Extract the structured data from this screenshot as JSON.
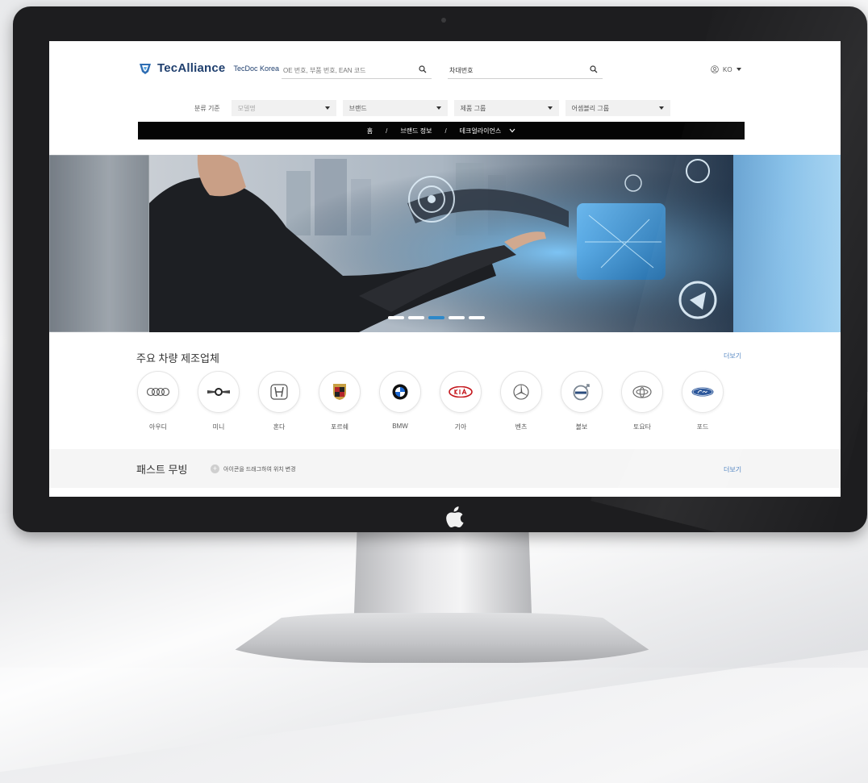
{
  "header": {
    "logo_text": "TecAlliance",
    "logo_sub": "TecDoc Korea",
    "search_placeholder": "OE 번호, 부품 번호, EAN 코드",
    "vin_value": "차대번호",
    "language": "KO"
  },
  "filters": {
    "label": "분류 기준",
    "items": [
      {
        "text": "모델명",
        "placeholder": true
      },
      {
        "text": "브랜드",
        "placeholder": false
      },
      {
        "text": "제품 그룹",
        "placeholder": false
      },
      {
        "text": "어셈블리 그룹",
        "placeholder": false
      }
    ]
  },
  "breadcrumb": {
    "items": [
      "홈",
      "브랜드 정보",
      "테크얼라이언스"
    ]
  },
  "carousel": {
    "slide_count": 5,
    "active_index": 2
  },
  "manufacturers": {
    "title": "주요 차량 제조업체",
    "more": "더보기",
    "brands": [
      {
        "name": "아우디",
        "icon": "audi-logo-icon"
      },
      {
        "name": "미니",
        "icon": "mini-logo-icon"
      },
      {
        "name": "혼다",
        "icon": "honda-logo-icon"
      },
      {
        "name": "포르쉐",
        "icon": "porsche-logo-icon"
      },
      {
        "name": "BMW",
        "icon": "bmw-logo-icon"
      },
      {
        "name": "기아",
        "icon": "kia-logo-icon"
      },
      {
        "name": "벤츠",
        "icon": "mercedes-logo-icon"
      },
      {
        "name": "볼보",
        "icon": "volvo-logo-icon"
      },
      {
        "name": "토요타",
        "icon": "toyota-logo-icon"
      },
      {
        "name": "포드",
        "icon": "ford-logo-icon"
      }
    ]
  },
  "fast_moving": {
    "title": "패스트 무빙",
    "hint": "아이콘을 드래그하여 위치 변경",
    "more": "더보기"
  },
  "colors": {
    "brand_navy": "#1f3f6e",
    "accent_blue": "#2d88c9",
    "link_blue": "#4a7fbf",
    "crumb_bg": "#050505"
  }
}
